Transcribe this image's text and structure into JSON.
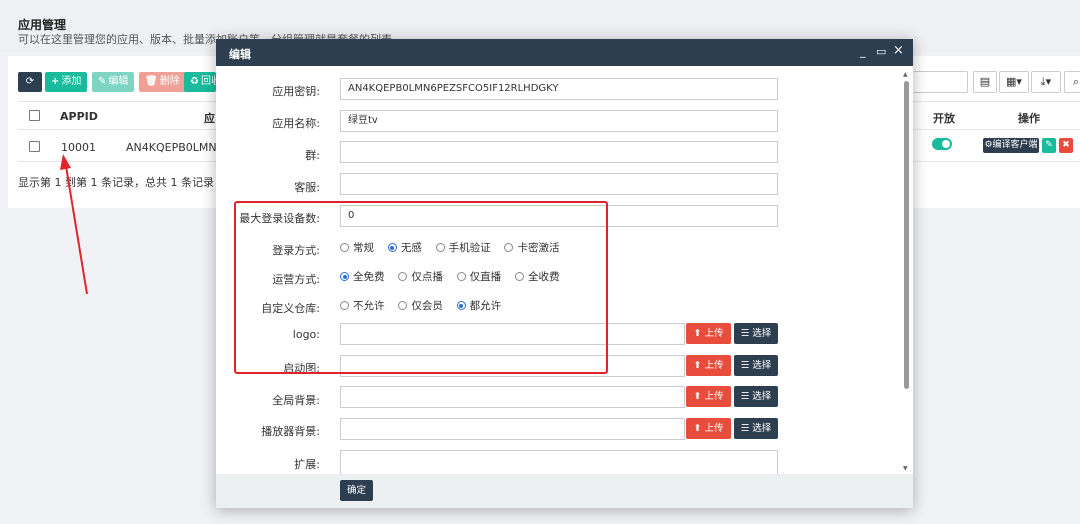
{
  "page": {
    "title": "应用管理",
    "subtitle": "可以在这里管理您的应用、版本、批量添加账户等，分组管理就是套餐的列表"
  },
  "toolbar": {
    "refresh_icon": "refresh-icon",
    "add_label": "添加",
    "edit_label": "编辑",
    "delete_label": "删除",
    "recycle_label": "回收",
    "colors": {
      "add": "#18bc9c",
      "edit": "#7fd5c4",
      "delete": "#f0a097",
      "refresh": "#2c3e50"
    }
  },
  "right_tools": {
    "columns_icon": "columns-icon",
    "grid_icon": "grid-icon",
    "export_icon": "export-icon",
    "search_icon": "search-icon"
  },
  "table": {
    "headers": {
      "appid": "APPID",
      "name": "应",
      "open": "开放",
      "ops": "操作"
    },
    "rows": [
      {
        "appid": "10001",
        "key": "AN4KQEPB0LMN6PE",
        "open": true,
        "compile_label": "编译客户端"
      }
    ],
    "footer": "显示第 1 到第 1 条记录，总共 1 条记录"
  },
  "modal": {
    "title": "编辑",
    "controls": {
      "minimize": "_",
      "restore": "▭",
      "close": "×"
    },
    "fields": {
      "app_key": {
        "label": "应用密钥:",
        "value": "AN4KQEPB0LMN6PEZSFCO5IF12RLHDGKY"
      },
      "app_name": {
        "label": "应用名称:",
        "value": "绿豆tv"
      },
      "group": {
        "label": "群:",
        "value": ""
      },
      "service": {
        "label": "客服:",
        "value": ""
      },
      "max_devices": {
        "label": "最大登录设备数:",
        "value": "0"
      },
      "login_mode": {
        "label": "登录方式:",
        "options": [
          "常规",
          "无感",
          "手机验证",
          "卡密激活"
        ],
        "selected": "无感"
      },
      "operation_mode": {
        "label": "运营方式:",
        "options": [
          "全免费",
          "仅点播",
          "仅直播",
          "全收费"
        ],
        "selected": "全免费"
      },
      "custom_repo": {
        "label": "自定义仓库:",
        "options": [
          "不允许",
          "仅会员",
          "都允许"
        ],
        "selected": "都允许"
      },
      "logo": {
        "label": "logo:",
        "value": ""
      },
      "splash": {
        "label": "启动图:",
        "value": ""
      },
      "global_bg": {
        "label": "全局背景:",
        "value": ""
      },
      "player_bg": {
        "label": "播放器背景:",
        "value": ""
      },
      "extend": {
        "label": "扩展:",
        "value": ""
      }
    },
    "upload_label": "上传",
    "select_label": "选择",
    "submit_label": "确定"
  }
}
